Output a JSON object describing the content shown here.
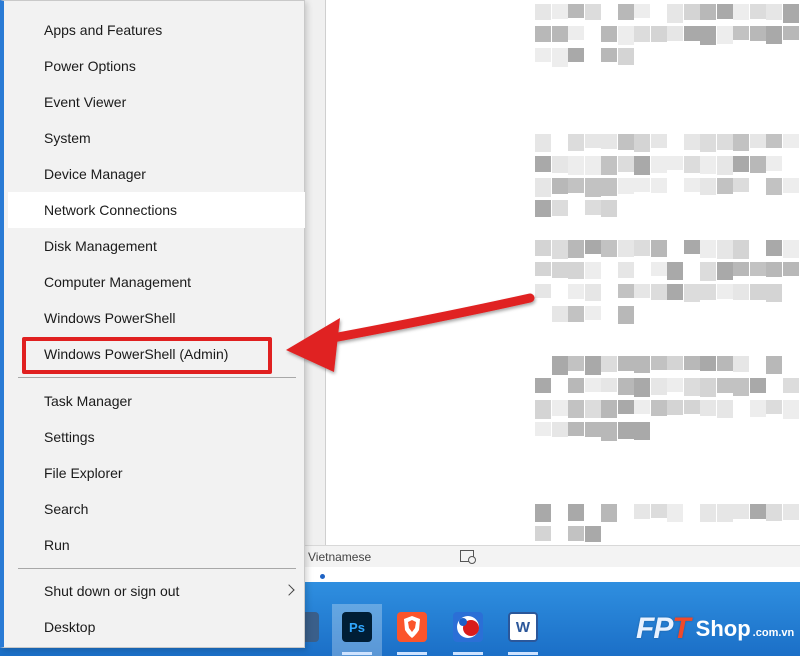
{
  "context_menu": {
    "items": [
      {
        "label": "Apps and Features"
      },
      {
        "label": "Power Options"
      },
      {
        "label": "Event Viewer"
      },
      {
        "label": "System"
      },
      {
        "label": "Device Manager"
      },
      {
        "label": "Network Connections",
        "hovered": true
      },
      {
        "label": "Disk Management"
      },
      {
        "label": "Computer Management"
      },
      {
        "label": "Windows PowerShell"
      },
      {
        "label": "Windows PowerShell (Admin)",
        "highlighted": true
      },
      {
        "label": "Task Manager"
      },
      {
        "label": "Settings"
      },
      {
        "label": "File Explorer"
      },
      {
        "label": "Search"
      },
      {
        "label": "Run"
      },
      {
        "label": "Shut down or sign out",
        "submenu": true
      },
      {
        "label": "Desktop"
      }
    ]
  },
  "status_bar": {
    "language": "Vietnamese",
    "view_icon": "read-mode-icon"
  },
  "taskbar": {
    "icons": [
      {
        "name": "photoshop-icon",
        "label": "Ps",
        "color": "#001e36",
        "text_color": "#31a8ff"
      },
      {
        "name": "brave-browser-icon",
        "label": "",
        "color": "#fb542b"
      },
      {
        "name": "paint-app-icon",
        "label": "",
        "color": "#2b6fd6"
      },
      {
        "name": "word-icon",
        "label": "W",
        "color": "#2b579a"
      }
    ]
  },
  "brand": {
    "f": "F",
    "p": "P",
    "t": "T",
    "shop": "Shop",
    "domain": ".com.vn"
  },
  "colors": {
    "accent": "#2a7bd5",
    "annotation": "#e02020",
    "taskbar": "#1b6fc7"
  }
}
